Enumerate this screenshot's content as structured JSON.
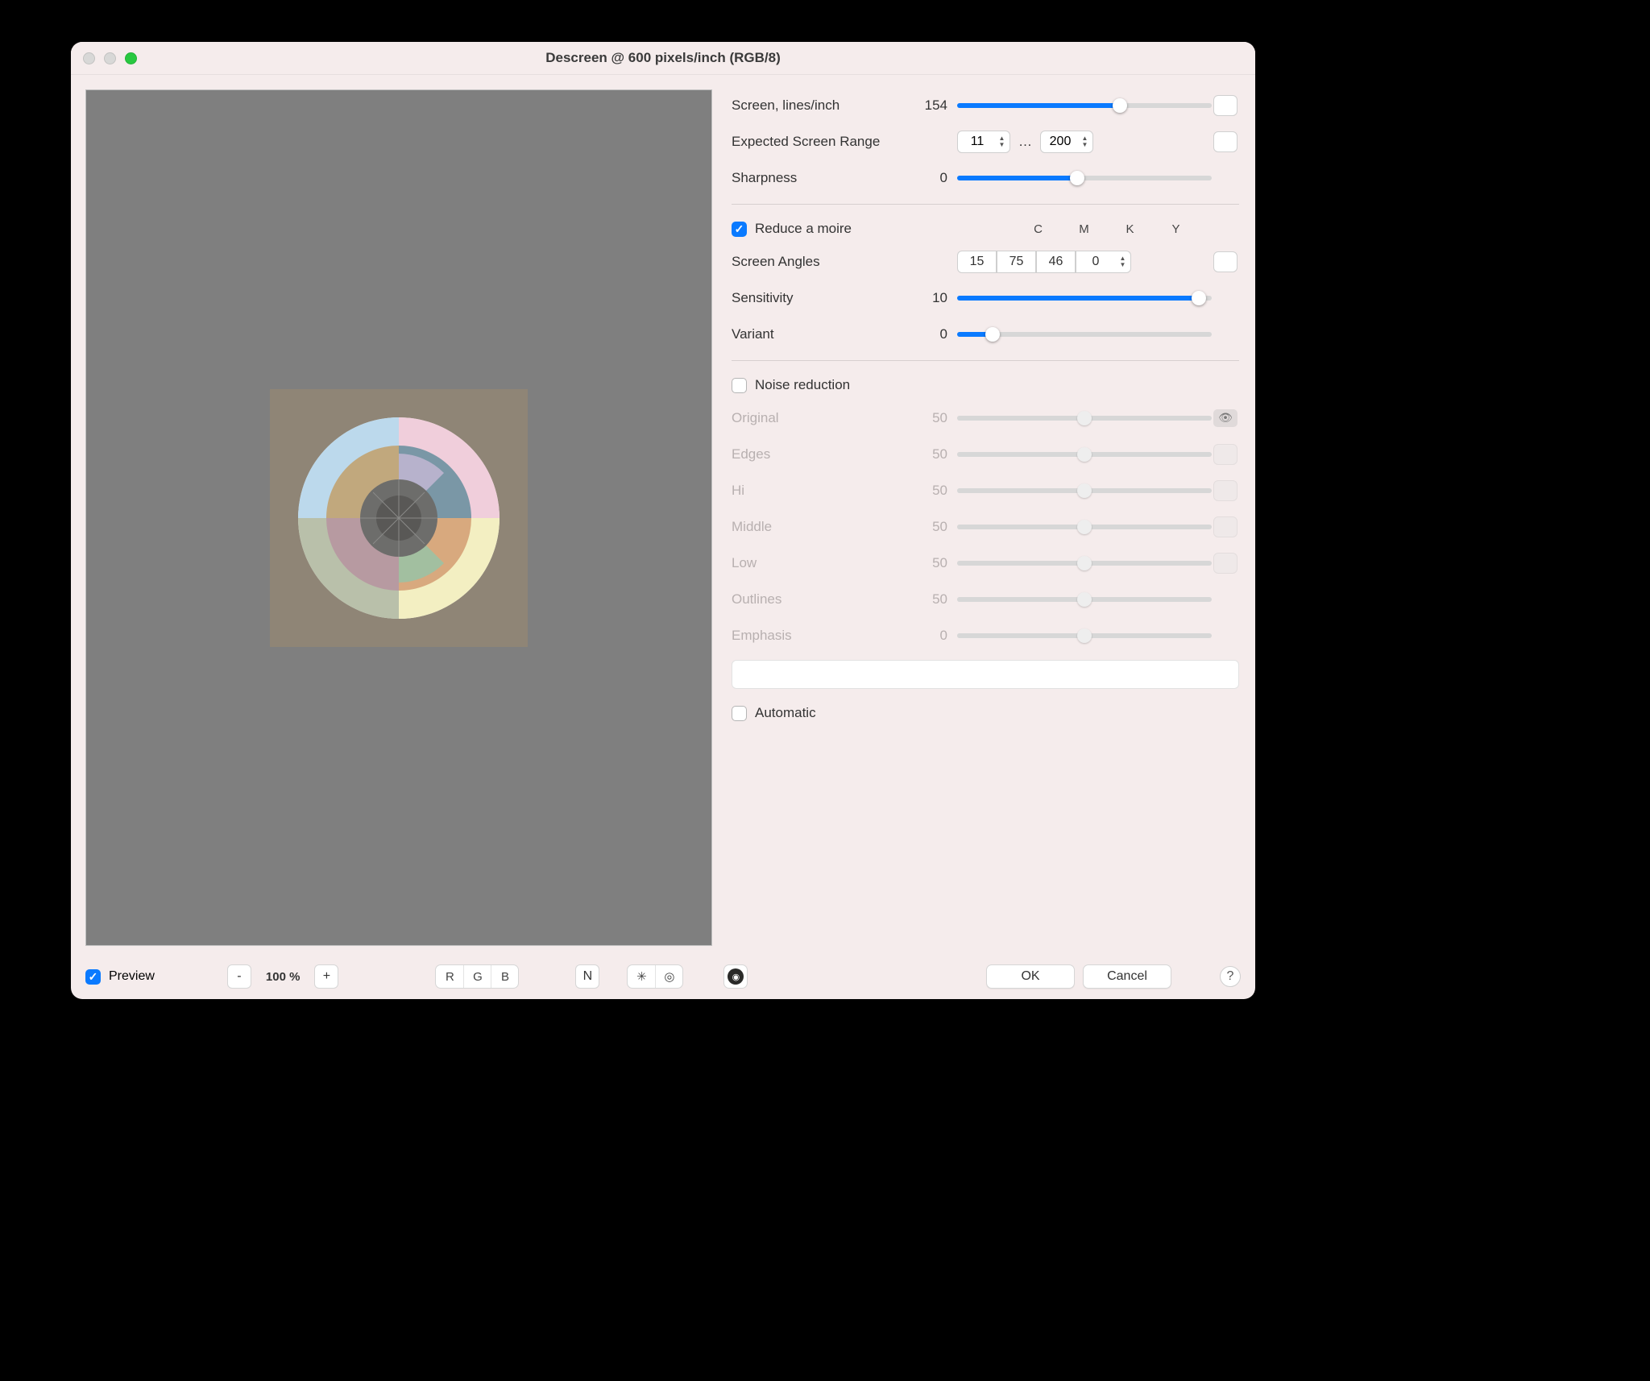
{
  "window": {
    "title": "Descreen @ 600 pixels/inch (RGB/8)"
  },
  "controls": {
    "screen_lines": {
      "label": "Screen, lines/inch",
      "value": "154",
      "fill_pct": 64
    },
    "expected_range": {
      "label": "Expected Screen Range",
      "min": "11",
      "max": "200",
      "sep": "…"
    },
    "sharpness": {
      "label": "Sharpness",
      "value": "0",
      "fill_pct": 47
    },
    "reduce_moire": {
      "label": "Reduce a moire",
      "checked": true
    },
    "screen_angles": {
      "label": "Screen Angles",
      "headers": {
        "c": "C",
        "m": "M",
        "k": "K",
        "y": "Y"
      },
      "values": {
        "c": "15",
        "m": "75",
        "k": "46",
        "y": "0"
      }
    },
    "sensitivity": {
      "label": "Sensitivity",
      "value": "10",
      "fill_pct": 95
    },
    "variant": {
      "label": "Variant",
      "value": "0",
      "fill_pct": 14
    },
    "noise_reduction": {
      "label": "Noise reduction",
      "checked": false
    },
    "nr": {
      "original": {
        "label": "Original",
        "value": "50",
        "fill_pct": 50
      },
      "edges": {
        "label": "Edges",
        "value": "50",
        "fill_pct": 50
      },
      "hi": {
        "label": "Hi",
        "value": "50",
        "fill_pct": 50
      },
      "middle": {
        "label": "Middle",
        "value": "50",
        "fill_pct": 50
      },
      "low": {
        "label": "Low",
        "value": "50",
        "fill_pct": 50
      },
      "outlines": {
        "label": "Outlines",
        "value": "50",
        "fill_pct": 50
      },
      "emphasis": {
        "label": "Emphasis",
        "value": "0",
        "fill_pct": 50
      }
    },
    "automatic": {
      "label": "Automatic",
      "checked": false
    }
  },
  "bottom": {
    "preview": {
      "label": "Preview",
      "checked": true
    },
    "zoom_out": "-",
    "zoom_label": "100 %",
    "zoom_in": "+",
    "seg_r": "R",
    "seg_g": "G",
    "seg_b": "B",
    "seg_n": "N",
    "seg_star": "✳",
    "seg_ring": "◎",
    "ok": "OK",
    "cancel": "Cancel",
    "help": "?"
  },
  "colors": {
    "accent": "#0a7aff"
  }
}
